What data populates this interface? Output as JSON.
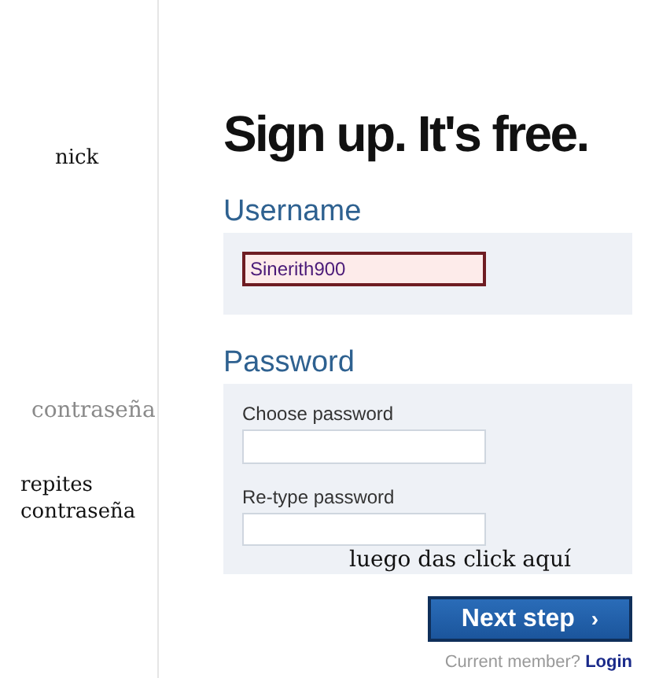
{
  "notes": [
    {
      "text": "nick",
      "color": "#111111"
    },
    {
      "text": "contraseña",
      "color": "#8a8a8a"
    },
    {
      "text": "repites contraseña",
      "color": "#111111"
    },
    {
      "text": "luego das click aquí",
      "color": "#111111"
    }
  ],
  "heading": "Sign up. It's free.",
  "username": {
    "label": "Username",
    "value": "Sinerith900",
    "error": true
  },
  "password": {
    "label": "Password",
    "fields": [
      {
        "label": "Choose password",
        "error": false
      },
      {
        "label": "Re-type password",
        "error": false
      }
    ]
  },
  "next_button": {
    "label": "Next step",
    "arrow": "›"
  },
  "login_prompt": {
    "text": "Current member?",
    "link": "Login"
  }
}
